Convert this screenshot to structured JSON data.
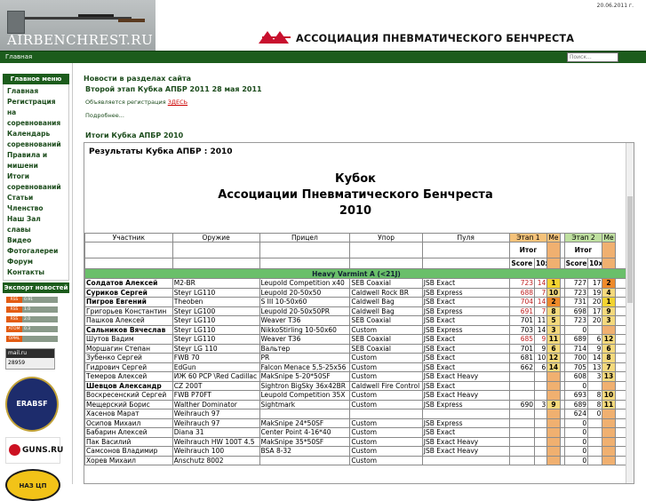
{
  "header": {
    "date": "20.06.2011 г.",
    "logo_text": "AIRBENCHREST.RU",
    "assoc_title": "АССОЦИАЦИЯ ПНЕВМАТИЧЕСКОГО БЕНЧРЕСТА"
  },
  "navbar": {
    "home": "Главная",
    "search_placeholder": "Поиск..."
  },
  "sidebar": {
    "menu_title": "Главное меню",
    "items": [
      "Главная",
      "Регистрация на соревнования",
      "Календарь соревнований",
      "Правила и мишени",
      "Итоги соревнований",
      "Статьи",
      "Членство",
      "Наш Зал славы",
      "Видео",
      "Фотогалереи",
      "Форум",
      "Контакты"
    ],
    "export_title": "Экспорт новостей",
    "rss": [
      {
        "a": "RSS",
        "b": "0.91"
      },
      {
        "a": "RSS",
        "b": "1.0"
      },
      {
        "a": "RSS",
        "b": "2.0"
      },
      {
        "a": "ATOM",
        "b": "0.3"
      },
      {
        "a": "OPML",
        "b": ""
      }
    ],
    "counter_brand": "mail.ru",
    "counter_num": "28959",
    "badges": [
      "ERABSF",
      "GUNS.RU",
      "НАЗ ЦП"
    ]
  },
  "main": {
    "news_heading": "Новости в разделах сайта",
    "news_title": "Второй этап Кубка АПБР 2011 28 мая 2011",
    "news_text": "Объявляется регистрация",
    "news_link": "ЗДЕСЬ",
    "more": "Подробнее...",
    "results_heading": "Итоги Кубка АПБР 2010"
  },
  "results": {
    "title": "Результаты Кубка АПБР : 2010",
    "cup_line1": "Кубок",
    "cup_line2": "Ассоциации Пневматического Бенчреста",
    "cup_line3": "2010",
    "columns": [
      "Участник",
      "Оружие",
      "Прицел",
      "Упор",
      "Пуля",
      "Этап 1",
      "Ме",
      "Этап 2",
      "Ме"
    ],
    "itog": "Итог",
    "score": "Score",
    "tenx": "10x",
    "class_name": "Heavy Varmint A (<21J)",
    "rows": [
      {
        "name": "Солдатов Алексей",
        "bold": true,
        "gun": "M2-BR",
        "scope": "Leupold Competition x40",
        "rest": "SEB Coaxial",
        "bullet": "JSB Exact",
        "s1": "723",
        "x1": "14",
        "p1": "1",
        "s2": "727",
        "x2": "17",
        "p2": "2",
        "red": true
      },
      {
        "name": "Суриков Сергей",
        "bold": true,
        "gun": "Steyr LG110",
        "scope": "Leupold 20-50x50",
        "rest": "Caldwell Rock BR",
        "bullet": "JSB Express",
        "s1": "688",
        "x1": "7",
        "p1": "10",
        "s2": "723",
        "x2": "19",
        "p2": "4",
        "red": true
      },
      {
        "name": "Пигров Евгений",
        "bold": true,
        "gun": "Theoben",
        "scope": "S III 10-50x60",
        "rest": "Caldwell Bag",
        "bullet": "JSB Exact",
        "s1": "704",
        "x1": "14",
        "p1": "2",
        "s2": "731",
        "x2": "20",
        "p2": "1",
        "red": true
      },
      {
        "name": "Григорьев Константин",
        "bold": false,
        "gun": "Steyr LG100",
        "scope": "Leupold 20-50x50PR",
        "rest": "Caldwell Bag",
        "bullet": "JSB Express",
        "s1": "691",
        "x1": "7",
        "p1": "8",
        "s2": "698",
        "x2": "17",
        "p2": "9",
        "red": true
      },
      {
        "name": "Пашков Алексей",
        "bold": false,
        "gun": "Steyr LG110",
        "scope": "Weaver T36",
        "rest": "SEB Coaxial",
        "bullet": "JSB Exact",
        "s1": "701",
        "x1": "11",
        "p1": "5",
        "s2": "723",
        "x2": "20",
        "p2": "3",
        "red": false
      },
      {
        "name": "Сальников Вячеслав",
        "bold": true,
        "gun": "Steyr LG110",
        "scope": "NikkoStirling 10-50x60",
        "rest": "Custom",
        "bullet": "JSB Express",
        "s1": "703",
        "x1": "14",
        "p1": "3",
        "s2": "0",
        "x2": "",
        "p2": "",
        "red": false
      },
      {
        "name": "Шутов Вадим",
        "bold": false,
        "gun": "Steyr LG110",
        "scope": "Weaver T36",
        "rest": "SEB Coaxial",
        "bullet": "JSB Exact",
        "s1": "685",
        "x1": "9",
        "p1": "11",
        "s2": "689",
        "x2": "6",
        "p2": "12",
        "red": true
      },
      {
        "name": "Моршагин Степан",
        "bold": false,
        "gun": "Steyr LG 110",
        "scope": "Вальтер",
        "rest": "SEB Coaxial",
        "bullet": "JSB Exact",
        "s1": "701",
        "x1": "9",
        "p1": "6",
        "s2": "714",
        "x2": "9",
        "p2": "6",
        "red": false
      },
      {
        "name": "Зубенко Сергей",
        "bold": false,
        "gun": "FWB 70",
        "scope": "PR",
        "rest": "Custom",
        "bullet": "JSB Exact",
        "s1": "681",
        "x1": "10",
        "p1": "12",
        "s2": "700",
        "x2": "14",
        "p2": "8",
        "red": false
      },
      {
        "name": "Гидрович Сергей",
        "bold": false,
        "gun": "EdGun",
        "scope": "Falcon Menace 5,5-25x56",
        "rest": "Custom",
        "bullet": "JSB Exact",
        "s1": "662",
        "x1": "6",
        "p1": "14",
        "s2": "705",
        "x2": "13",
        "p2": "7",
        "red": false
      },
      {
        "name": "Темеров Алексей",
        "bold": false,
        "gun": "ИЖ 60 PCP \\Red Cadillac",
        "scope": "MakSnipe 5-20*50SF",
        "rest": "Custom",
        "bullet": "JSB Exact Heavy",
        "s1": "",
        "x1": "",
        "p1": "",
        "s2": "608",
        "x2": "3",
        "p2": "13",
        "red": false
      },
      {
        "name": "Шевцов Александр",
        "bold": true,
        "gun": "CZ 200T",
        "scope": "Sightron BigSky 36x42BR",
        "rest": "Caldwell Fire Control",
        "bullet": "JSB Exact",
        "s1": "",
        "x1": "",
        "p1": "",
        "s2": "0",
        "x2": "",
        "p2": "",
        "red": false
      },
      {
        "name": "Воскресенский Сергей",
        "bold": false,
        "gun": "FWB P70FT",
        "scope": "Leupold Competition 35X",
        "rest": "Custom",
        "bullet": "JSB Exact Heavy",
        "s1": "",
        "x1": "",
        "p1": "",
        "s2": "693",
        "x2": "8",
        "p2": "10",
        "red": false
      },
      {
        "name": "Мещерский Борис",
        "bold": false,
        "gun": "Walther Dominator",
        "scope": "Sightmark",
        "rest": "Custom",
        "bullet": "JSB Express",
        "s1": "690",
        "x1": "3",
        "p1": "9",
        "s2": "689",
        "x2": "8",
        "p2": "11",
        "red": false
      },
      {
        "name": "Хасенов Марат",
        "bold": false,
        "gun": "Weihrauch 97",
        "scope": "",
        "rest": "",
        "bullet": "",
        "s1": "",
        "x1": "",
        "p1": "",
        "s2": "624",
        "x2": "0",
        "p2": "",
        "red": false
      },
      {
        "name": "Осипов Михаил",
        "bold": false,
        "gun": "Weihrauch 97",
        "scope": "MakSnipe 24*50SF",
        "rest": "Custom",
        "bullet": "JSB Express",
        "s1": "",
        "x1": "",
        "p1": "",
        "s2": "0",
        "x2": "",
        "p2": "",
        "red": false
      },
      {
        "name": "Бабарин Алексей",
        "bold": false,
        "gun": "Diana 31",
        "scope": "Center Point 4-16*40",
        "rest": "Custom",
        "bullet": "JSB Exact",
        "s1": "",
        "x1": "",
        "p1": "",
        "s2": "0",
        "x2": "",
        "p2": "",
        "red": false
      },
      {
        "name": "Пак Василий",
        "bold": false,
        "gun": "Weihrauch HW 100T 4.5",
        "scope": "MakSnipe 35*50SF",
        "rest": "Custom",
        "bullet": "JSB Exact Heavy",
        "s1": "",
        "x1": "",
        "p1": "",
        "s2": "0",
        "x2": "",
        "p2": "",
        "red": false
      },
      {
        "name": "Самсонов Владимир",
        "bold": false,
        "gun": "Weihrauch 100",
        "scope": "BSA 8-32",
        "rest": "Custom",
        "bullet": "JSB Exact Heavy",
        "s1": "",
        "x1": "",
        "p1": "",
        "s2": "0",
        "x2": "",
        "p2": "",
        "red": false
      },
      {
        "name": "Хорев Михаил",
        "bold": false,
        "gun": "Anschutz 8002",
        "scope": "",
        "rest": "Custom",
        "bullet": "",
        "s1": "",
        "x1": "",
        "p1": "",
        "s2": "0",
        "x2": "",
        "p2": "",
        "red": false
      }
    ]
  },
  "colors": {
    "green": "#1c5c1c",
    "stage1": "#f5c27a",
    "stage2": "#bfe0a0",
    "class_bar": "#6abf6a"
  }
}
